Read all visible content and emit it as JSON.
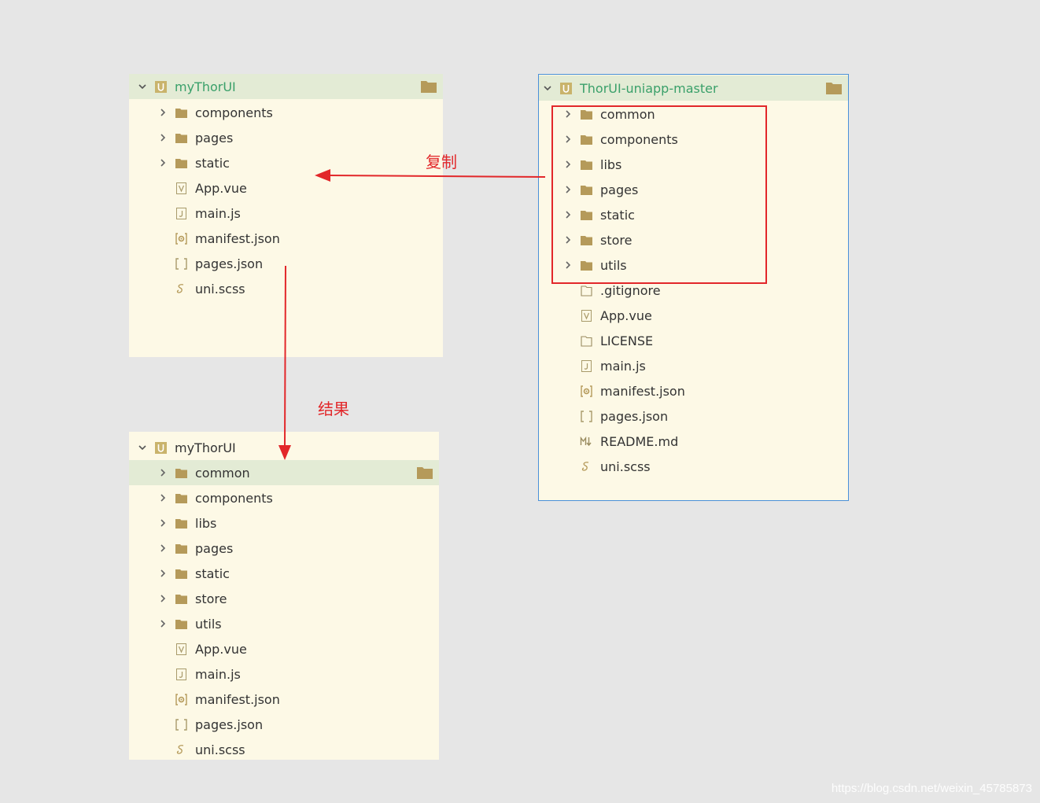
{
  "panel_top_left": {
    "root": "myThorUI",
    "items": [
      {
        "label": "components",
        "type": "folder"
      },
      {
        "label": "pages",
        "type": "folder"
      },
      {
        "label": "static",
        "type": "folder"
      },
      {
        "label": "App.vue",
        "type": "vue"
      },
      {
        "label": "main.js",
        "type": "js"
      },
      {
        "label": "manifest.json",
        "type": "manifest"
      },
      {
        "label": "pages.json",
        "type": "json"
      },
      {
        "label": "uni.scss",
        "type": "scss"
      }
    ]
  },
  "panel_right": {
    "root": "ThorUI-uniapp-master",
    "items": [
      {
        "label": "common",
        "type": "folder"
      },
      {
        "label": "components",
        "type": "folder"
      },
      {
        "label": "libs",
        "type": "folder"
      },
      {
        "label": "pages",
        "type": "folder"
      },
      {
        "label": "static",
        "type": "folder"
      },
      {
        "label": "store",
        "type": "folder"
      },
      {
        "label": "utils",
        "type": "folder"
      },
      {
        "label": ".gitignore",
        "type": "file"
      },
      {
        "label": "App.vue",
        "type": "vue"
      },
      {
        "label": "LICENSE",
        "type": "file"
      },
      {
        "label": "main.js",
        "type": "js"
      },
      {
        "label": "manifest.json",
        "type": "manifest"
      },
      {
        "label": "pages.json",
        "type": "json"
      },
      {
        "label": "README.md",
        "type": "md"
      },
      {
        "label": "uni.scss",
        "type": "scss"
      }
    ]
  },
  "panel_bottom_left": {
    "root": "myThorUI",
    "items": [
      {
        "label": "common",
        "type": "folder"
      },
      {
        "label": "components",
        "type": "folder"
      },
      {
        "label": "libs",
        "type": "folder"
      },
      {
        "label": "pages",
        "type": "folder"
      },
      {
        "label": "static",
        "type": "folder"
      },
      {
        "label": "store",
        "type": "folder"
      },
      {
        "label": "utils",
        "type": "folder"
      },
      {
        "label": "App.vue",
        "type": "vue"
      },
      {
        "label": "main.js",
        "type": "js"
      },
      {
        "label": "manifest.json",
        "type": "manifest"
      },
      {
        "label": "pages.json",
        "type": "json"
      },
      {
        "label": "uni.scss",
        "type": "scss"
      }
    ]
  },
  "annotations": {
    "copy": "复制",
    "result": "结果"
  },
  "watermark": "https://blog.csdn.net/weixin_45785873",
  "colors": {
    "accent_red": "#e2272a",
    "panel_bg": "#fdf9e6",
    "selected_bg": "#e3ebd5",
    "root_text": "#3aa06a",
    "folder": "#b59a5a",
    "panel_border": "#4a90d9"
  }
}
